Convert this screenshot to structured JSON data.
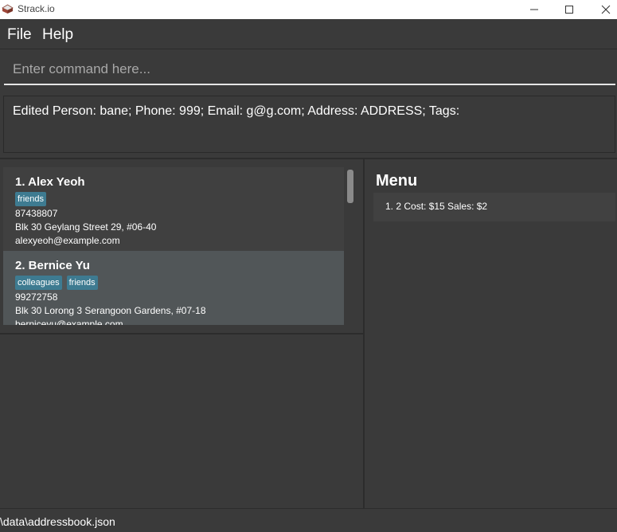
{
  "window": {
    "title": "Strack.io",
    "icons": {
      "app": "cake-icon",
      "minimize": "minimize-icon",
      "maximize": "maximize-icon",
      "close": "close-icon"
    }
  },
  "menubar": {
    "file": "File",
    "help": "Help"
  },
  "command": {
    "placeholder": "Enter command here...",
    "value": ""
  },
  "result": {
    "text": "Edited Person: bane; Phone: 999; Email: g@g.com; Address: ADDRESS; Tags:"
  },
  "persons": [
    {
      "name": "1.  Alex Yeoh",
      "tags": [
        "friends"
      ],
      "phone": "87438807",
      "address": "Blk 30 Geylang Street 29, #06-40",
      "email": "alexyeoh@example.com"
    },
    {
      "name": "2.  Bernice Yu",
      "tags": [
        "colleagues",
        "friends"
      ],
      "phone": "99272758",
      "address": "Blk 30 Lorong 3 Serangoon Gardens, #07-18",
      "email": "berniceyu@example.com"
    }
  ],
  "menu_panel": {
    "title": "Menu",
    "items": [
      "1. 2  Cost: $15  Sales: $2"
    ]
  },
  "status": {
    "path": "\\data\\addressbook.json"
  },
  "colors": {
    "background": "#3a3a3a",
    "tag": "#3e7b91",
    "selected_card": "#515658",
    "card": "#404040"
  }
}
